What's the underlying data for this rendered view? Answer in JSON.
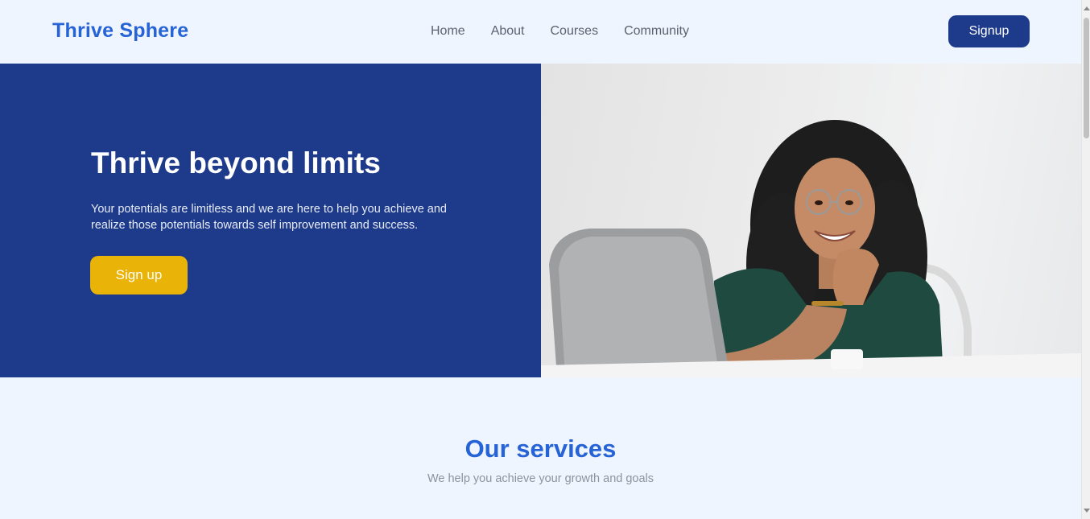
{
  "header": {
    "logo": "Thrive Sphere",
    "nav": [
      "Home",
      "About",
      "Courses",
      "Community"
    ],
    "signup_label": "Signup"
  },
  "hero": {
    "title": "Thrive beyond limits",
    "text": "Your potentials are limitless and we are here to help you achieve and realize those potentials towards self improvement and success.",
    "cta_label": "Sign up",
    "image_description": "smiling woman with curly hair and glasses sitting at a laptop"
  },
  "services": {
    "title": "Our services",
    "subtitle": "We help you achieve your growth and goals"
  },
  "colors": {
    "primary_dark": "#1e3a8a",
    "primary": "#2563d6",
    "accent": "#eab308",
    "background": "#eef5ff"
  }
}
